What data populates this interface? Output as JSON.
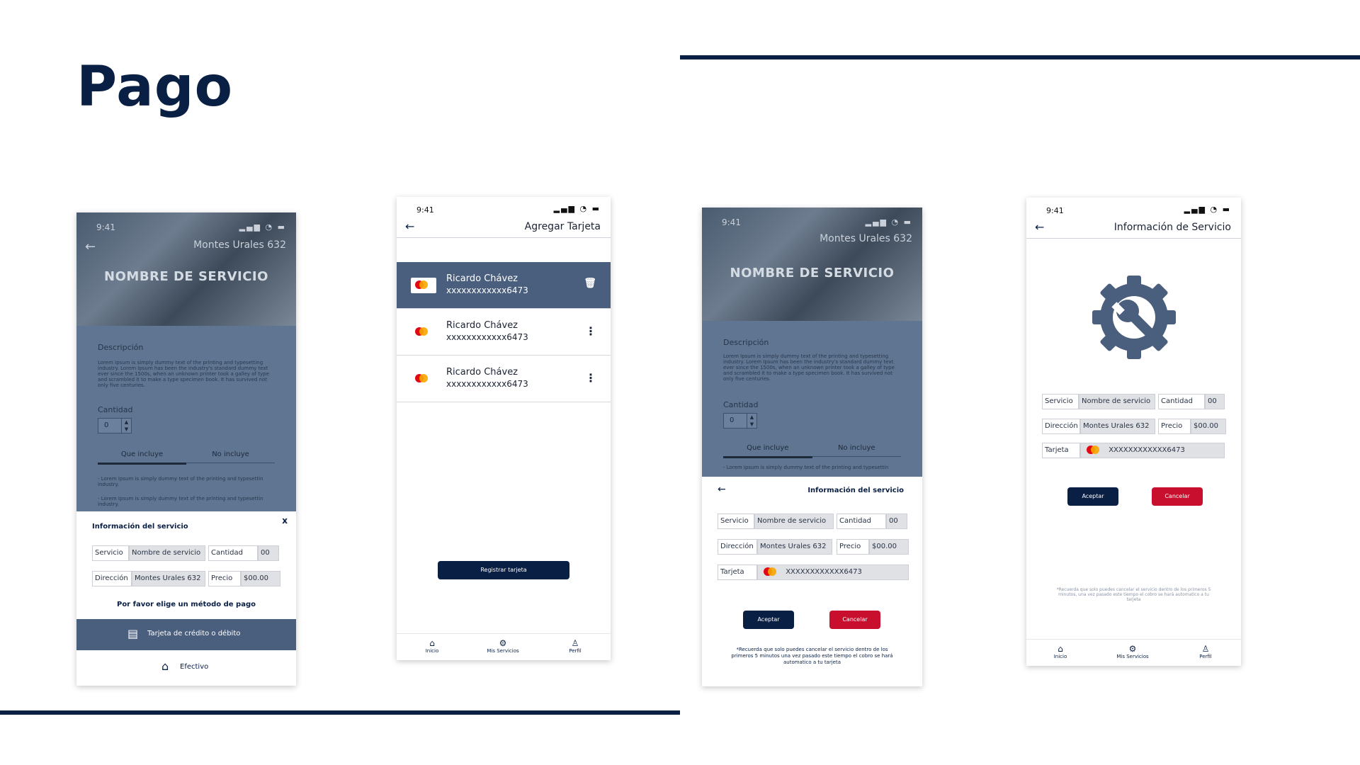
{
  "slide": {
    "title": "Pago"
  },
  "colors": {
    "navy": "#0a1f44",
    "red": "#c8102e",
    "slate": "#5f7591"
  },
  "phone1": {
    "time": "9:41",
    "address": "Montes Urales 632",
    "service_name": "NOMBRE DE SERVICIO",
    "description_label": "Descripción",
    "lorem": "Lorem Ipsum is simply dummy text of the printing and typesetting industry. Lorem Ipsum has been the industry's standard dummy text ever since the 1500s, when an unknown printer took a galley of type and scrambled it to make a type specimen book. It has survived not only five centuries.",
    "quantity_label": "Cantidad",
    "quantity_value": "0",
    "tab_includes": "Que incluye",
    "tab_excludes": "No incluye",
    "bullet1": "- Lorem Ipsum is simply dummy text of the printing and typesettin industry.",
    "bullet2": "- Lorem Ipsum is simply dummy text of the printing and typesettin industry.",
    "sheet_title": "Información del servicio",
    "close": "x",
    "servicio_label": "Servicio",
    "servicio_value": "Nombre de servicio",
    "cantidad_label": "Cantidad",
    "cantidad_value": "00",
    "direccion_label": "Dirección",
    "direccion_value": "Montes Urales 632",
    "precio_label": "Precio",
    "precio_value": "$00.00",
    "choose_method": "Por favor elige un método de pago",
    "card_option": "Tarjeta de crédito o débito",
    "cash_option": "Efectivo"
  },
  "phone2": {
    "time": "9:41",
    "title": "Agregar Tarjeta",
    "cards": [
      {
        "name": "Ricardo Chávez",
        "number": "xxxxxxxxxxxx6473"
      },
      {
        "name": "Ricardo Chávez",
        "number": "xxxxxxxxxxxx6473"
      },
      {
        "name": "Ricardo Chávez",
        "number": "xxxxxxxxxxxx6473"
      }
    ],
    "register_button": "Registrar tarjeta",
    "nav": {
      "home": "Inicio",
      "services": "Mis Servicios",
      "profile": "Perfil"
    }
  },
  "phone3": {
    "time": "9:41",
    "address": "Montes Urales 632",
    "service_name": "NOMBRE DE SERVICIO",
    "description_label": "Descripción",
    "lorem": "Lorem Ipsum is simply dummy text of the printing and typesetting industry. Lorem Ipsum has been the industry's standard dummy text ever since the 1500s, when an unknown printer took a galley of type and scrambled it to make a type specimen book. It has survived not only five centuries.",
    "quantity_label": "Cantidad",
    "quantity_value": "0",
    "tab_includes": "Que incluye",
    "tab_excludes": "No incluye",
    "bullet1": "- Lorem Ipsum is simply dummy text of the printing and typesettin",
    "sheet_title": "Información del servicio",
    "servicio_label": "Servicio",
    "servicio_value": "Nombre de servicio",
    "cantidad_label": "Cantidad",
    "cantidad_value": "00",
    "direccion_label": "Dirección",
    "direccion_value": "Montes Urales 632",
    "precio_label": "Precio",
    "precio_value": "$00.00",
    "tarjeta_label": "Tarjeta",
    "tarjeta_value": "XXXXXXXXXXXX6473",
    "accept": "Aceptar",
    "cancel": "Cancelar",
    "note": "*Recuerda que solo puedes cancelar el servicio dentro de los primeros 5 minutos una vez pasado este tiempo el cobro se hará automatico a tu tarjeta"
  },
  "phone4": {
    "time": "9:41",
    "title": "Información de Servicio",
    "servicio_label": "Servicio",
    "servicio_value": "Nombre de servicio",
    "cantidad_label": "Cantidad",
    "cantidad_value": "00",
    "direccion_label": "Dirección",
    "direccion_value": "Montes Urales 632",
    "precio_label": "Precio",
    "precio_value": "$00.00",
    "tarjeta_label": "Tarjeta",
    "tarjeta_value": "XXXXXXXXXXXX6473",
    "accept": "Aceptar",
    "cancel": "Cancelar",
    "note": "*Recuerda que solo puedes cancelar el servicio dentro de los primeros 5 minutos, una vez pasado este tiempo el cobro se hará automatico a tu tarjeta",
    "nav": {
      "home": "Inicio",
      "services": "Mis Servicios",
      "profile": "Perfil"
    }
  }
}
